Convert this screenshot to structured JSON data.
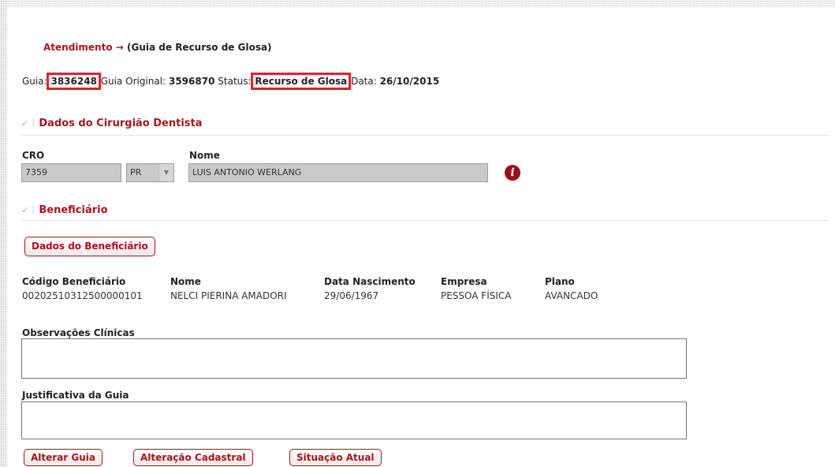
{
  "breadcrumb": {
    "section": "Atendimento",
    "separator": "→",
    "page": "(Guia de Recurso de Glosa)"
  },
  "guide_info": {
    "guia_label": "Guia:",
    "guia_value": "3836248",
    "original_label": "Guia Original:",
    "original_value": "3596870",
    "status_label": "Status:",
    "status_value": "Recurso de Glosa",
    "data_label": "Data:",
    "data_value": "26/10/2015"
  },
  "dentist_section": {
    "title": "Dados do Cirurgião Dentista",
    "cro_label": "CRO",
    "cro_value": "7359",
    "uf_value": "PR",
    "nome_label": "Nome",
    "nome_value": "LUIS ANTONIO WERLANG"
  },
  "beneficiary_section": {
    "title": "Beneficiário",
    "button_label": "Dados do Beneficiário",
    "columns": {
      "codigo": "Código Beneficiário",
      "nome": "Nome",
      "nascimento": "Data Nascimento",
      "empresa": "Empresa",
      "plano": "Plano"
    },
    "values": {
      "codigo": "00202510312500000101",
      "nome": "NELCI PIERINA AMADORI",
      "nascimento": "29/06/1967",
      "empresa": "PESSOA FÍSICA",
      "plano": "AVANCADO"
    }
  },
  "observacoes": {
    "label": "Observações Clínicas",
    "value": ""
  },
  "justificativa": {
    "label": "Justificativa da Guia",
    "value": ""
  },
  "actions": {
    "alterar": "Alterar Guia",
    "cadastral": "Alteração Cadastral",
    "situacao": "Situação Atual"
  },
  "icons": {
    "info": "info-icon",
    "section_marker": "check-icon"
  },
  "colors": {
    "accent": "#a8151d",
    "highlight": "#e3212a"
  }
}
